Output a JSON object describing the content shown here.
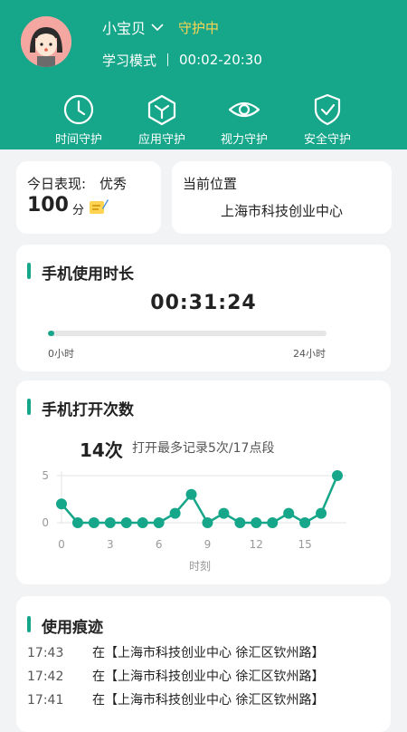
{
  "profile": {
    "name": "小宝贝",
    "status": "守护中",
    "mode": "学习模式",
    "schedule": "00:02-20:30"
  },
  "features": [
    {
      "label": "时间守护",
      "icon": "clock-icon"
    },
    {
      "label": "应用守护",
      "icon": "app-cube-icon"
    },
    {
      "label": "视力守护",
      "icon": "eye-icon"
    },
    {
      "label": "安全守护",
      "icon": "shield-check-icon"
    }
  ],
  "today": {
    "label": "今日表现:",
    "rating": "优秀",
    "score": "100",
    "unit": "分"
  },
  "location": {
    "label": "当前位置",
    "value": "上海市科技创业中心"
  },
  "usage": {
    "title": "手机使用时长",
    "duration": "00:31:24",
    "progress": 0.022,
    "start_label": "0小时",
    "end_label": "24小时"
  },
  "opens": {
    "title": "手机打开次数",
    "count": "14次",
    "note": "打开最多记录5次/17点段"
  },
  "chart_data": {
    "type": "line",
    "x": [
      0,
      1,
      2,
      3,
      4,
      5,
      6,
      7,
      8,
      9,
      10,
      11,
      12,
      13,
      14,
      15,
      16,
      17
    ],
    "y": [
      2,
      0,
      0,
      0,
      0,
      0,
      0,
      1,
      3,
      0,
      1,
      0,
      0,
      0,
      1,
      0,
      1,
      5
    ],
    "xticks": [
      "0",
      "3",
      "6",
      "9",
      "12",
      "15"
    ],
    "yticks": [
      "0",
      "5"
    ],
    "xlabel": "时刻",
    "ylim": [
      0,
      5
    ],
    "color": "#16a68a"
  },
  "traces": {
    "title": "使用痕迹",
    "items": [
      {
        "time": "17:43",
        "text": "在【上海市科技创业中心 徐汇区钦州路】"
      },
      {
        "time": "17:42",
        "text": "在【上海市科技创业中心 徐汇区钦州路】"
      },
      {
        "time": "17:41",
        "text": "在【上海市科技创业中心 徐汇区钦州路】"
      }
    ]
  }
}
